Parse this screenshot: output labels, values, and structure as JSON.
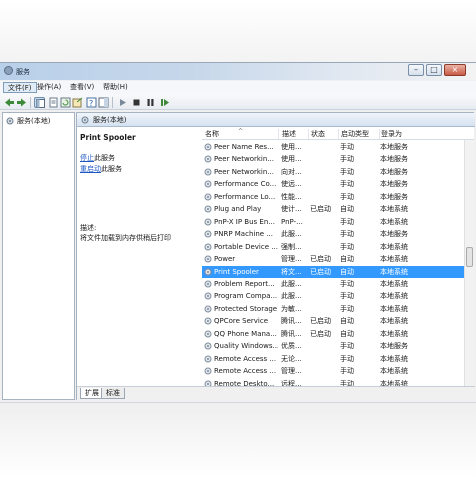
{
  "window": {
    "title": "服务"
  },
  "menubar": {
    "items": [
      "文件(F)",
      "操作(A)",
      "查看(V)",
      "帮助(H)"
    ]
  },
  "tree": {
    "root_label": "服务(本地)"
  },
  "main": {
    "header_title": "服务(本地)"
  },
  "details": {
    "service_name": "Print Spooler",
    "stop_link": "停止",
    "stop_suffix": "此服务",
    "restart_link": "重启动",
    "restart_suffix": "此服务",
    "description_label": "描述:",
    "description_text": "将文件加载到内存供稍后打印"
  },
  "columns": {
    "name": "名称",
    "desc": "描述",
    "status": "状态",
    "startup": "启动类型",
    "logon": "登录为"
  },
  "services": [
    {
      "name": "Peer Name Res...",
      "desc": "使用...",
      "status": "",
      "startup": "手动",
      "logon": "本地服务"
    },
    {
      "name": "Peer Networkin...",
      "desc": "使用...",
      "status": "",
      "startup": "手动",
      "logon": "本地服务"
    },
    {
      "name": "Peer Networkin...",
      "desc": "向对...",
      "status": "",
      "startup": "手动",
      "logon": "本地服务"
    },
    {
      "name": "Performance Co...",
      "desc": "使远...",
      "status": "",
      "startup": "手动",
      "logon": "本地服务"
    },
    {
      "name": "Performance Lo...",
      "desc": "性能...",
      "status": "",
      "startup": "手动",
      "logon": "本地服务"
    },
    {
      "name": "Plug and Play",
      "desc": "使计...",
      "status": "已启动",
      "startup": "自动",
      "logon": "本地系统"
    },
    {
      "name": "PnP-X IP Bus En...",
      "desc": "PnP-...",
      "status": "",
      "startup": "手动",
      "logon": "本地系统"
    },
    {
      "name": "PNRP Machine ...",
      "desc": "此服...",
      "status": "",
      "startup": "手动",
      "logon": "本地服务"
    },
    {
      "name": "Portable Device ...",
      "desc": "强制...",
      "status": "",
      "startup": "手动",
      "logon": "本地系统"
    },
    {
      "name": "Power",
      "desc": "管理...",
      "status": "已启动",
      "startup": "自动",
      "logon": "本地系统"
    },
    {
      "name": "Print Spooler",
      "desc": "将文...",
      "status": "已启动",
      "startup": "自动",
      "logon": "本地系统",
      "selected": true
    },
    {
      "name": "Problem Report...",
      "desc": "此服...",
      "status": "",
      "startup": "手动",
      "logon": "本地系统"
    },
    {
      "name": "Program Compa...",
      "desc": "此服...",
      "status": "",
      "startup": "手动",
      "logon": "本地系统"
    },
    {
      "name": "Protected Storage",
      "desc": "为敏...",
      "status": "",
      "startup": "手动",
      "logon": "本地系统"
    },
    {
      "name": "QPCore Service",
      "desc": "腾讯...",
      "status": "已启动",
      "startup": "自动",
      "logon": "本地系统"
    },
    {
      "name": "QQ Phone Mana...",
      "desc": "腾讯...",
      "status": "已启动",
      "startup": "自动",
      "logon": "本地系统"
    },
    {
      "name": "Quality Windows...",
      "desc": "优质...",
      "status": "",
      "startup": "手动",
      "logon": "本地服务"
    },
    {
      "name": "Remote Access ...",
      "desc": "无论...",
      "status": "",
      "startup": "手动",
      "logon": "本地系统"
    },
    {
      "name": "Remote Access ...",
      "desc": "管理...",
      "status": "",
      "startup": "手动",
      "logon": "本地系统"
    },
    {
      "name": "Remote Deskto...",
      "desc": "远程...",
      "status": "",
      "startup": "手动",
      "logon": "本地系统"
    }
  ],
  "tabs": [
    "扩展",
    "标准"
  ],
  "colors": {
    "selection": "#3399ff",
    "link": "#1c56c4",
    "title_gradient": "#b9d0ea"
  }
}
